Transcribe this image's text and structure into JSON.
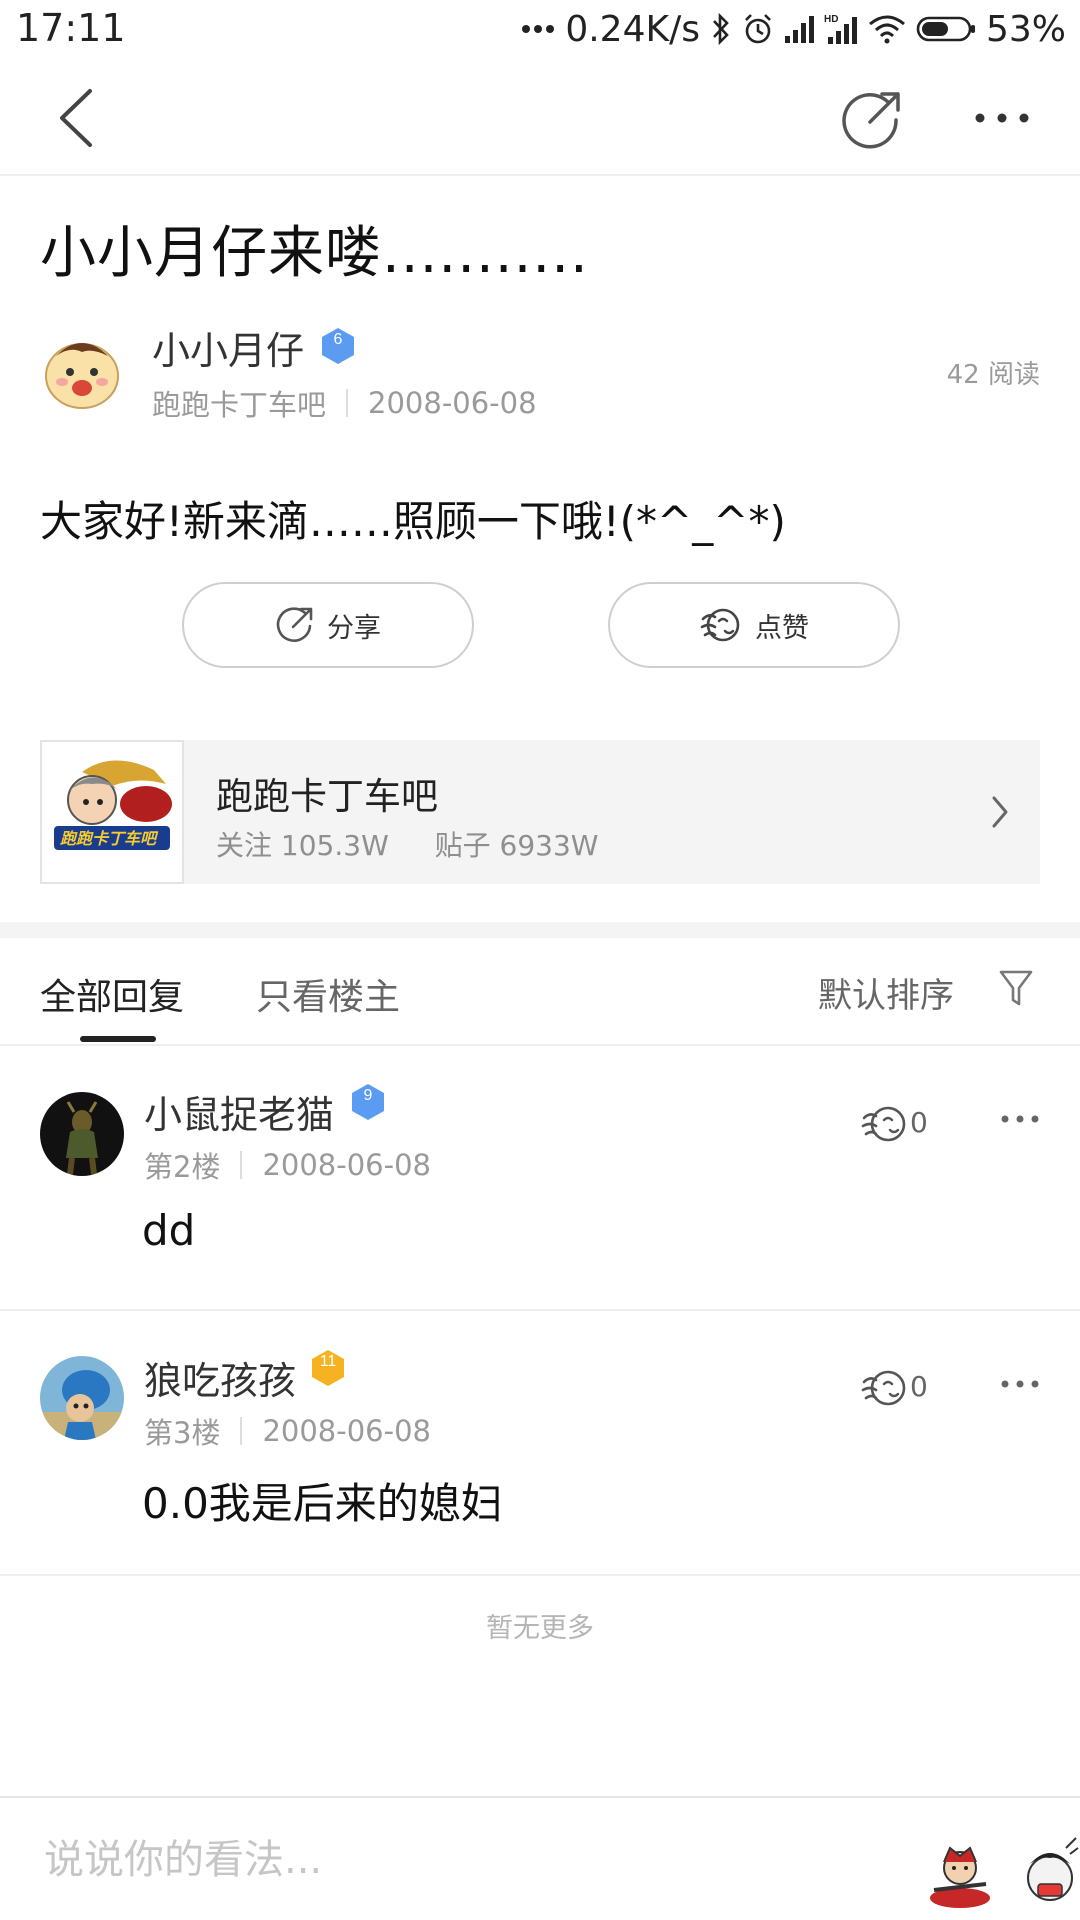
{
  "status_bar": {
    "time": "17:11",
    "net_speed": "0.24K/s",
    "battery": "53%"
  },
  "nav": {
    "back_icon": "chevron-left-icon",
    "share_icon": "share-arrow-icon",
    "more_icon": "more-dots-icon"
  },
  "post": {
    "title": "小小月仔来喽...........",
    "author": {
      "name": "小小月仔",
      "level": "6",
      "forum": "跑跑卡丁车吧",
      "date": "2008-06-08"
    },
    "read_count": "42 阅读",
    "body": "大家好!新来滴……照顾一下哦!(*^_^*)",
    "share_label": "分享",
    "like_label": "点赞"
  },
  "forum_card": {
    "name": "跑跑卡丁车吧",
    "follow_label": "关注",
    "follow_count": "105.3W",
    "posts_label": "贴子",
    "posts_count": "6933W",
    "logo_text": "跑跑卡丁车吧"
  },
  "tabs": {
    "all_replies": "全部回复",
    "owner_only": "只看楼主",
    "sort": "默认排序"
  },
  "replies": [
    {
      "name": "小鼠捉老猫",
      "level": "9",
      "floor": "第2楼",
      "date": "2008-06-08",
      "likes": "0",
      "body": "dd"
    },
    {
      "name": "狼吃孩孩",
      "level": "11",
      "floor": "第3楼",
      "date": "2008-06-08",
      "likes": "0",
      "body": "0.0我是后来的媳妇"
    }
  ],
  "footer": {
    "no_more": "暂无更多"
  },
  "composer": {
    "placeholder": "说说你的看法..."
  },
  "colors": {
    "level_blue": "#5b9cf2",
    "level_gold": "#f5b324",
    "text_primary": "#222222",
    "text_secondary": "#9a9a9a"
  }
}
